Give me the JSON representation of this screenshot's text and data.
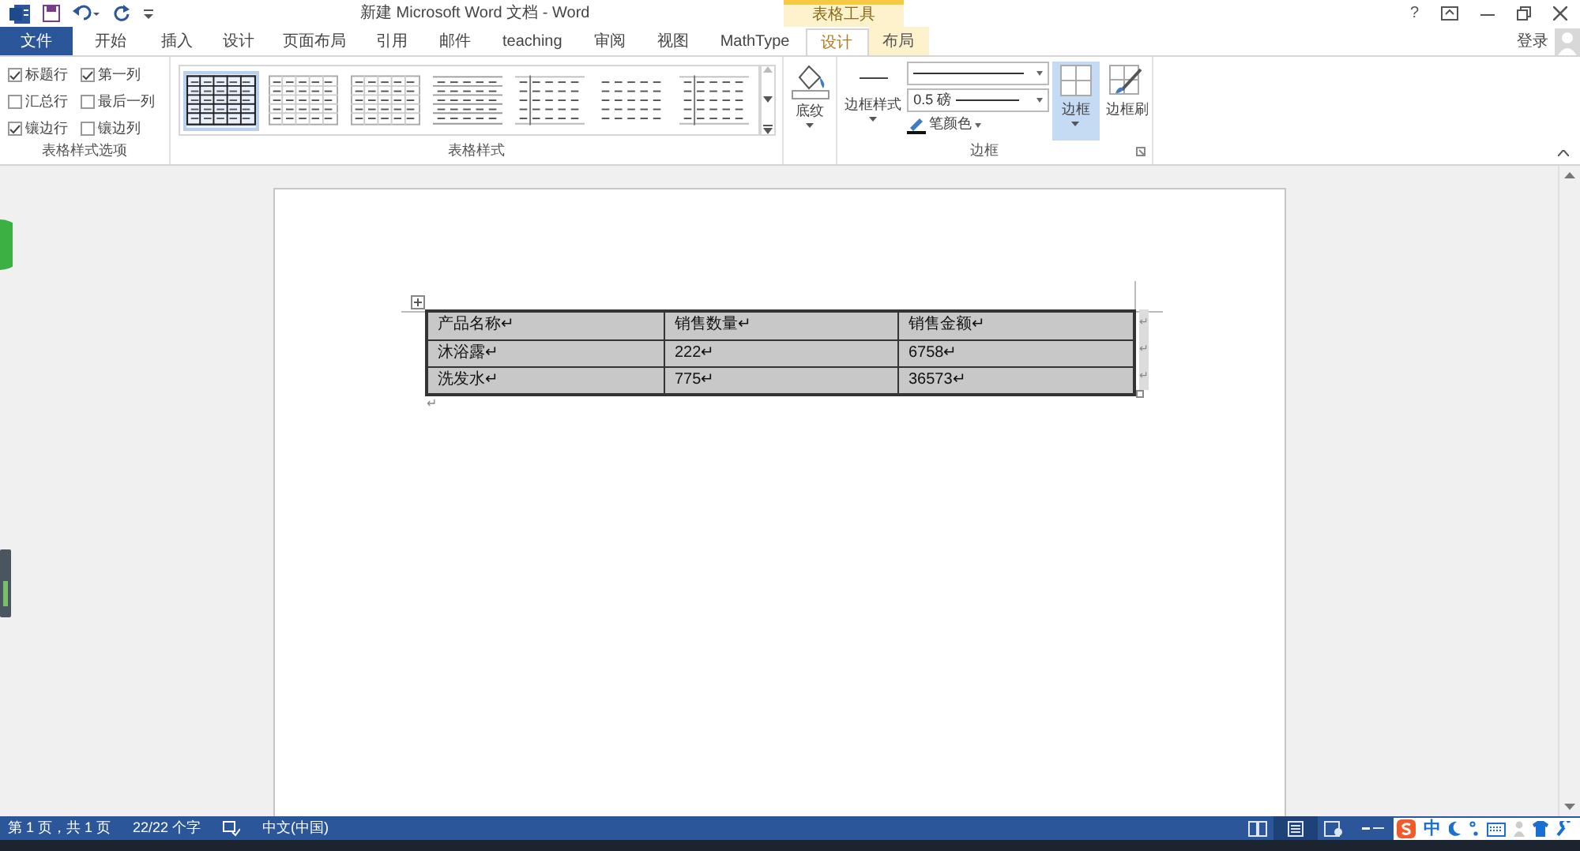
{
  "window": {
    "title": "新建 Microsoft Word 文档 - Word",
    "help": "?",
    "context_group": "表格工具",
    "login": "登录"
  },
  "tabs": [
    {
      "label": "文件",
      "kind": "file",
      "selected": false
    },
    {
      "label": "开始",
      "kind": "normal",
      "selected": false
    },
    {
      "label": "插入",
      "kind": "normal",
      "selected": false
    },
    {
      "label": "设计",
      "kind": "normal",
      "selected": false
    },
    {
      "label": "页面布局",
      "kind": "normal",
      "selected": false
    },
    {
      "label": "引用",
      "kind": "normal",
      "selected": false
    },
    {
      "label": "邮件",
      "kind": "normal",
      "selected": false
    },
    {
      "label": "teaching",
      "kind": "normal",
      "selected": false
    },
    {
      "label": "审阅",
      "kind": "normal",
      "selected": false
    },
    {
      "label": "视图",
      "kind": "normal",
      "selected": false
    },
    {
      "label": "MathType",
      "kind": "normal",
      "selected": false
    },
    {
      "label": "设计",
      "kind": "context",
      "selected": true
    },
    {
      "label": "布局",
      "kind": "context",
      "selected": false
    }
  ],
  "style_options": {
    "label": "表格样式选项",
    "options": [
      {
        "label": "标题行",
        "checked": true
      },
      {
        "label": "第一列",
        "checked": true
      },
      {
        "label": "汇总行",
        "checked": false
      },
      {
        "label": "最后一列",
        "checked": false
      },
      {
        "label": "镶边行",
        "checked": true
      },
      {
        "label": "镶边列",
        "checked": false
      }
    ]
  },
  "table_styles": {
    "label": "表格样式",
    "styles": [
      {
        "kind": "grid",
        "selected": true
      },
      {
        "kind": "light-grid",
        "selected": false
      },
      {
        "kind": "light-grid",
        "selected": false
      },
      {
        "kind": "lines",
        "selected": false
      },
      {
        "kind": "first-col",
        "selected": false
      },
      {
        "kind": "plain",
        "selected": false
      },
      {
        "kind": "first-col",
        "selected": false
      }
    ]
  },
  "shading": {
    "label": "底纹"
  },
  "borders": {
    "label": "边框",
    "border_styles": "边框样式",
    "weight": "0.5 磅",
    "pen_color": "笔颜色",
    "borders_button": {
      "label": "边框",
      "pressed": true
    },
    "border_painter": "边框刷"
  },
  "document": {
    "table": {
      "rows": [
        {
          "cells": [
            "产品名称↵",
            "销售数量↵",
            "销售金额↵"
          ],
          "end_mark": "↵"
        },
        {
          "cells": [
            "沐浴露↵",
            "222↵",
            "6758↵"
          ],
          "end_mark": "↵"
        },
        {
          "cells": [
            "洗发水↵",
            "775↵",
            "36573↵"
          ],
          "end_mark": "↵"
        }
      ]
    },
    "after_table": "↵"
  },
  "status_bar": {
    "items": [
      "第 1 页，共 1 页",
      "22/22 个字",
      "中文(中国)"
    ]
  },
  "ime_bar": {
    "mode": "中"
  }
}
